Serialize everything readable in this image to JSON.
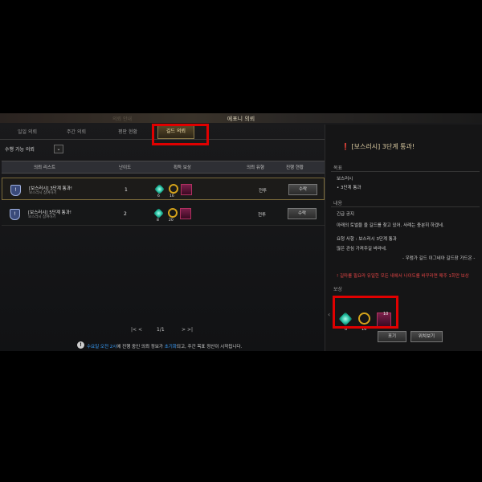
{
  "window": {
    "title": "에포니 의뢰",
    "ghost_title": "의뢰 안내"
  },
  "tabs": [
    {
      "label": "일일 의뢰"
    },
    {
      "label": "주간 의뢰"
    },
    {
      "label": "평판 현황"
    },
    {
      "label": "길드 의뢰",
      "active": true
    }
  ],
  "filter": {
    "label": "수행 가능 의뢰",
    "dropdown_icon": "chevron-down"
  },
  "table": {
    "headers": [
      "의뢰 리스트",
      "난이도",
      "획득 보상",
      "의뢰 유형",
      "진행 현황"
    ],
    "rows": [
      {
        "title": "[보스러시] 3단계 통과!",
        "sub": "보스러시 참여하기",
        "difficulty": "1",
        "rewards": [
          {
            "icon": "gem-icon",
            "count": "6"
          },
          {
            "icon": "wreath-icon",
            "count": "16"
          },
          {
            "icon": "chest-icon",
            "count": ""
          }
        ],
        "type": "전투",
        "button": "수락",
        "selected": true
      },
      {
        "title": "[보스러시] 5단계 통과!",
        "sub": "보스러시 참여하기",
        "difficulty": "2",
        "rewards": [
          {
            "icon": "gem-icon",
            "count": "8"
          },
          {
            "icon": "wreath-icon",
            "count": "20"
          },
          {
            "icon": "chest-icon",
            "count": ""
          }
        ],
        "type": "전투",
        "button": "수락",
        "selected": false
      }
    ]
  },
  "pager": {
    "first": "|<",
    "prev": "<",
    "info": "1/1",
    "next": ">",
    "last": ">|"
  },
  "notice": {
    "pre": "수요일 오전 2시",
    "mid": "에 진행 중인 의뢰 정보가 ",
    "highlight": "초기화",
    "post": "되고, 주간 목표 정산이 시작됩니다."
  },
  "detail": {
    "title": "[보스러시] 3단계 통과!",
    "goal_head": "목표",
    "goal_name": "보스러시",
    "goal_item": "• 3단계 통과",
    "content_head": "내용",
    "content_lines": [
      "긴급 공지",
      "아래의 토벌을 을 길드를 찾고 있어. 사례는 충분히 하겠네.",
      "요청 사항 : 보스러시 3단계 통과",
      "많은 관심 가져주길 바라네.",
      "- 우럼가 길드 이그네아 길드장 가드온 -"
    ],
    "warning": "! 길마를 필요라 유일한 모든 내에서 나이도를 바꾸라면 매주 1회만 보상",
    "reward_head": "보상",
    "rewards": [
      {
        "icon": "gem-icon",
        "count": "6"
      },
      {
        "icon": "wreath-icon",
        "count": "16"
      },
      {
        "icon": "chest-icon",
        "count": "",
        "qty": "10"
      }
    ],
    "buttons": [
      "포기",
      "위치보기"
    ]
  },
  "colors": {
    "highlight_border": "#e00000",
    "notice_blue": "#3aa0ff",
    "warning_red": "#e54545"
  }
}
